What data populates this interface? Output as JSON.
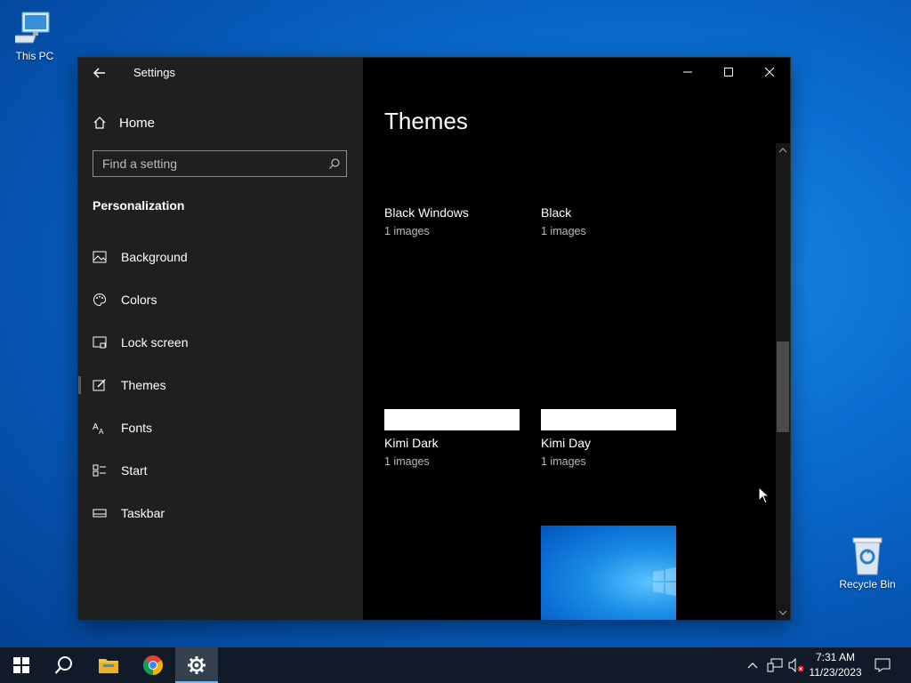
{
  "desktop": {
    "icons": [
      {
        "label": "This PC"
      },
      {
        "label": "Recycle Bin"
      }
    ]
  },
  "window": {
    "app_title": "Settings",
    "nav": {
      "home_label": "Home",
      "search_placeholder": "Find a setting",
      "section_heading": "Personalization",
      "items": [
        {
          "label": "Background",
          "icon": "picture-icon"
        },
        {
          "label": "Colors",
          "icon": "palette-icon"
        },
        {
          "label": "Lock screen",
          "icon": "lock-screen-icon"
        },
        {
          "label": "Themes",
          "icon": "brush-icon",
          "selected": true
        },
        {
          "label": "Fonts",
          "icon": "font-icon"
        },
        {
          "label": "Start",
          "icon": "start-icon"
        },
        {
          "label": "Taskbar",
          "icon": "taskbar-icon"
        }
      ]
    },
    "content": {
      "title": "Themes",
      "themes": [
        {
          "name": "Black Windows",
          "count": "1 images"
        },
        {
          "name": "Black",
          "count": "1 images"
        },
        {
          "name": "Kimi Dark",
          "count": "1 images"
        },
        {
          "name": "Kimi Day",
          "count": "1 images"
        }
      ]
    }
  },
  "taskbar": {
    "apps": [
      "windows-start-icon",
      "search-icon",
      "file-explorer-icon",
      "chrome-icon",
      "settings-gear-icon"
    ],
    "clock": {
      "time": "7:31 AM",
      "date": "11/23/2023"
    }
  },
  "colors": {
    "nav_bg": "#1f1f1f",
    "content_bg": "#000000",
    "taskbar_bg": "#101a28",
    "desktop_blue": "#0a6ed1"
  }
}
